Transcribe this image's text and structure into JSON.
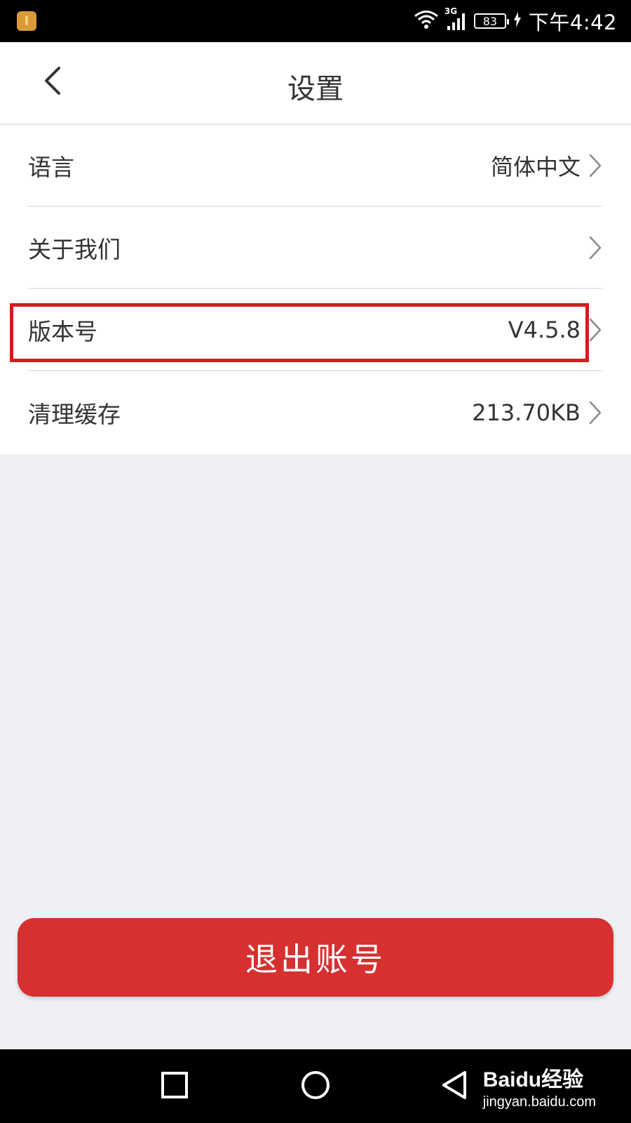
{
  "status_bar": {
    "network": "3G",
    "battery": "83",
    "time": "下午4:42"
  },
  "header": {
    "title": "设置",
    "back_icon": "chevron-left-icon"
  },
  "settings": {
    "items": [
      {
        "label": "语言",
        "value": "简体中文"
      },
      {
        "label": "关于我们",
        "value": ""
      },
      {
        "label": "版本号",
        "value": "V4.5.8"
      },
      {
        "label": "清理缓存",
        "value": "213.70KB"
      }
    ]
  },
  "logout": {
    "label": "退出账号"
  },
  "nav_bar": {
    "watermark_main": "Baidu经验",
    "watermark_sub": "jingyan.baidu.com"
  },
  "colors": {
    "accent": "#d63031",
    "highlight": "#c8221e",
    "background": "#eef0f4"
  }
}
